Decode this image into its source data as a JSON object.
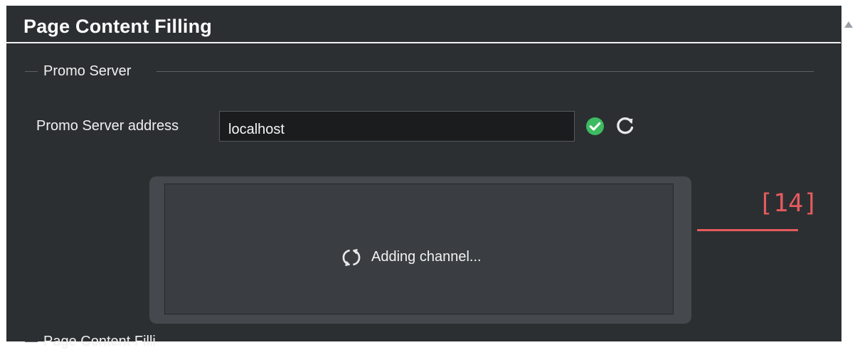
{
  "page": {
    "title": "Page Content Filling"
  },
  "promo_server_group": {
    "title": "Promo Server",
    "address_label": "Promo Server address",
    "address_value": "localhost",
    "status_icon": "check-circle-icon",
    "refresh_icon": "refresh-icon"
  },
  "loading_overlay": {
    "status_text": "Adding channel...",
    "spinner_icon": "loading-spinner-icon"
  },
  "annotation": {
    "label": "[14]",
    "color": "#e45b5e"
  },
  "next_group": {
    "title_partial": "Page Content Filli"
  },
  "colors": {
    "background": "#2c2f32",
    "success": "#3dbb61",
    "input_background": "#1b1c1e"
  }
}
